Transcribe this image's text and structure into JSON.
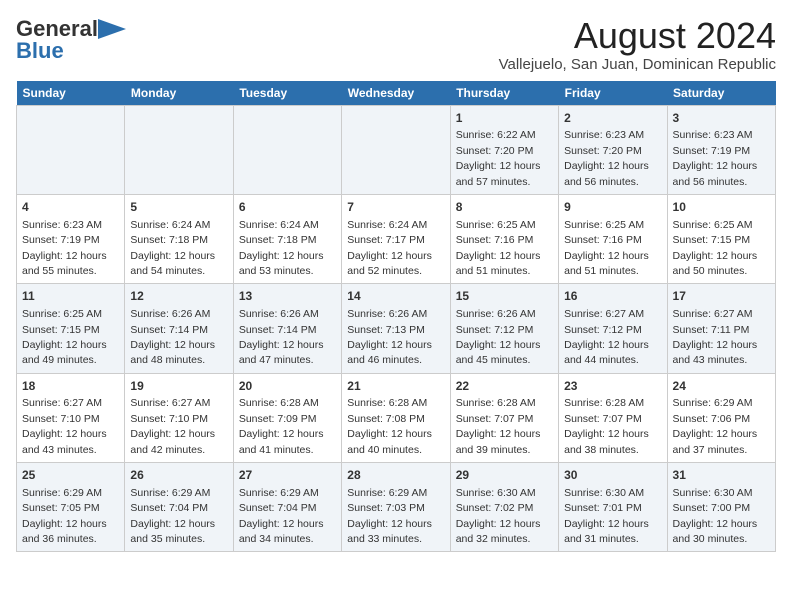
{
  "logo": {
    "line1": "General",
    "line2": "Blue"
  },
  "title": "August 2024",
  "subtitle": "Vallejuelo, San Juan, Dominican Republic",
  "days_of_week": [
    "Sunday",
    "Monday",
    "Tuesday",
    "Wednesday",
    "Thursday",
    "Friday",
    "Saturday"
  ],
  "weeks": [
    [
      {
        "day": "",
        "content": ""
      },
      {
        "day": "",
        "content": ""
      },
      {
        "day": "",
        "content": ""
      },
      {
        "day": "",
        "content": ""
      },
      {
        "day": "1",
        "content": "Sunrise: 6:22 AM\nSunset: 7:20 PM\nDaylight: 12 hours\nand 57 minutes."
      },
      {
        "day": "2",
        "content": "Sunrise: 6:23 AM\nSunset: 7:20 PM\nDaylight: 12 hours\nand 56 minutes."
      },
      {
        "day": "3",
        "content": "Sunrise: 6:23 AM\nSunset: 7:19 PM\nDaylight: 12 hours\nand 56 minutes."
      }
    ],
    [
      {
        "day": "4",
        "content": "Sunrise: 6:23 AM\nSunset: 7:19 PM\nDaylight: 12 hours\nand 55 minutes."
      },
      {
        "day": "5",
        "content": "Sunrise: 6:24 AM\nSunset: 7:18 PM\nDaylight: 12 hours\nand 54 minutes."
      },
      {
        "day": "6",
        "content": "Sunrise: 6:24 AM\nSunset: 7:18 PM\nDaylight: 12 hours\nand 53 minutes."
      },
      {
        "day": "7",
        "content": "Sunrise: 6:24 AM\nSunset: 7:17 PM\nDaylight: 12 hours\nand 52 minutes."
      },
      {
        "day": "8",
        "content": "Sunrise: 6:25 AM\nSunset: 7:16 PM\nDaylight: 12 hours\nand 51 minutes."
      },
      {
        "day": "9",
        "content": "Sunrise: 6:25 AM\nSunset: 7:16 PM\nDaylight: 12 hours\nand 51 minutes."
      },
      {
        "day": "10",
        "content": "Sunrise: 6:25 AM\nSunset: 7:15 PM\nDaylight: 12 hours\nand 50 minutes."
      }
    ],
    [
      {
        "day": "11",
        "content": "Sunrise: 6:25 AM\nSunset: 7:15 PM\nDaylight: 12 hours\nand 49 minutes."
      },
      {
        "day": "12",
        "content": "Sunrise: 6:26 AM\nSunset: 7:14 PM\nDaylight: 12 hours\nand 48 minutes."
      },
      {
        "day": "13",
        "content": "Sunrise: 6:26 AM\nSunset: 7:14 PM\nDaylight: 12 hours\nand 47 minutes."
      },
      {
        "day": "14",
        "content": "Sunrise: 6:26 AM\nSunset: 7:13 PM\nDaylight: 12 hours\nand 46 minutes."
      },
      {
        "day": "15",
        "content": "Sunrise: 6:26 AM\nSunset: 7:12 PM\nDaylight: 12 hours\nand 45 minutes."
      },
      {
        "day": "16",
        "content": "Sunrise: 6:27 AM\nSunset: 7:12 PM\nDaylight: 12 hours\nand 44 minutes."
      },
      {
        "day": "17",
        "content": "Sunrise: 6:27 AM\nSunset: 7:11 PM\nDaylight: 12 hours\nand 43 minutes."
      }
    ],
    [
      {
        "day": "18",
        "content": "Sunrise: 6:27 AM\nSunset: 7:10 PM\nDaylight: 12 hours\nand 43 minutes."
      },
      {
        "day": "19",
        "content": "Sunrise: 6:27 AM\nSunset: 7:10 PM\nDaylight: 12 hours\nand 42 minutes."
      },
      {
        "day": "20",
        "content": "Sunrise: 6:28 AM\nSunset: 7:09 PM\nDaylight: 12 hours\nand 41 minutes."
      },
      {
        "day": "21",
        "content": "Sunrise: 6:28 AM\nSunset: 7:08 PM\nDaylight: 12 hours\nand 40 minutes."
      },
      {
        "day": "22",
        "content": "Sunrise: 6:28 AM\nSunset: 7:07 PM\nDaylight: 12 hours\nand 39 minutes."
      },
      {
        "day": "23",
        "content": "Sunrise: 6:28 AM\nSunset: 7:07 PM\nDaylight: 12 hours\nand 38 minutes."
      },
      {
        "day": "24",
        "content": "Sunrise: 6:29 AM\nSunset: 7:06 PM\nDaylight: 12 hours\nand 37 minutes."
      }
    ],
    [
      {
        "day": "25",
        "content": "Sunrise: 6:29 AM\nSunset: 7:05 PM\nDaylight: 12 hours\nand 36 minutes."
      },
      {
        "day": "26",
        "content": "Sunrise: 6:29 AM\nSunset: 7:04 PM\nDaylight: 12 hours\nand 35 minutes."
      },
      {
        "day": "27",
        "content": "Sunrise: 6:29 AM\nSunset: 7:04 PM\nDaylight: 12 hours\nand 34 minutes."
      },
      {
        "day": "28",
        "content": "Sunrise: 6:29 AM\nSunset: 7:03 PM\nDaylight: 12 hours\nand 33 minutes."
      },
      {
        "day": "29",
        "content": "Sunrise: 6:30 AM\nSunset: 7:02 PM\nDaylight: 12 hours\nand 32 minutes."
      },
      {
        "day": "30",
        "content": "Sunrise: 6:30 AM\nSunset: 7:01 PM\nDaylight: 12 hours\nand 31 minutes."
      },
      {
        "day": "31",
        "content": "Sunrise: 6:30 AM\nSunset: 7:00 PM\nDaylight: 12 hours\nand 30 minutes."
      }
    ]
  ]
}
